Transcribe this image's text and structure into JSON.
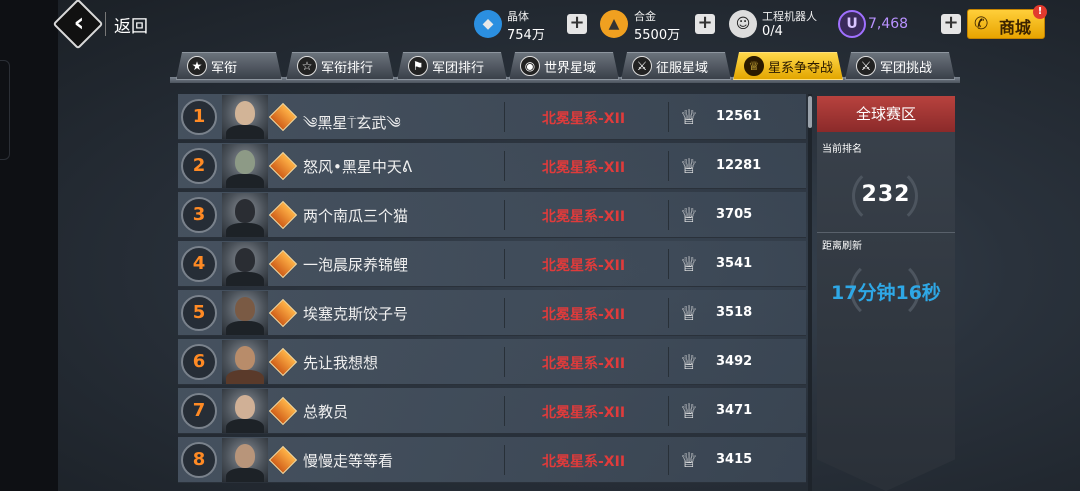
{
  "topbar": {
    "back_label": "返回",
    "resources": [
      {
        "title": "晶体",
        "value": "754万",
        "icon": "crystal-icon",
        "color": "#2b8fe0"
      },
      {
        "title": "合金",
        "value": "5500万",
        "icon": "alloy-icon",
        "color": "#f0a020"
      },
      {
        "title": "工程机器人",
        "value": "0/4",
        "icon": "robot-icon",
        "color": "#dddddd"
      }
    ],
    "currency": {
      "value": "7,468",
      "icon": "u-coin-icon",
      "color": "#a070ff"
    },
    "shop_label": "商城",
    "shop_badge": "!"
  },
  "tabs": [
    {
      "label": "军衔",
      "icon": "rank-icon",
      "active": false
    },
    {
      "label": "军衔排行",
      "icon": "rank-list-icon",
      "active": false
    },
    {
      "label": "军团排行",
      "icon": "legion-rank-icon",
      "active": false
    },
    {
      "label": "世界星域",
      "icon": "world-icon",
      "active": false
    },
    {
      "label": "征服星域",
      "icon": "conquer-icon",
      "active": false
    },
    {
      "label": "星系争夺战",
      "icon": "trophy-icon",
      "active": true
    },
    {
      "label": "军团挑战",
      "icon": "legion-challenge-icon",
      "active": false
    }
  ],
  "rankings": [
    {
      "rank": "1",
      "name": "༄黑星⍑玄武༄",
      "galaxy": "北冕星系-XII",
      "score": "12561"
    },
    {
      "rank": "2",
      "name": "怒风•黑星中天ᕕ",
      "galaxy": "北冕星系-XII",
      "score": "12281"
    },
    {
      "rank": "3",
      "name": "两个南瓜三个猫",
      "galaxy": "北冕星系-XII",
      "score": "3705"
    },
    {
      "rank": "4",
      "name": "一泡晨尿养锦鲤",
      "galaxy": "北冕星系-XII",
      "score": "3541"
    },
    {
      "rank": "5",
      "name": "埃塞克斯饺子号",
      "galaxy": "北冕星系-XII",
      "score": "3518"
    },
    {
      "rank": "6",
      "name": "先让我想想",
      "galaxy": "北冕星系-XII",
      "score": "3492"
    },
    {
      "rank": "7",
      "name": "总教员",
      "galaxy": "北冕星系-XII",
      "score": "3471"
    },
    {
      "rank": "8",
      "name": "慢慢走等等看",
      "galaxy": "北冕星系-XII",
      "score": "3415"
    }
  ],
  "panel": {
    "title": "全球赛区",
    "current_rank_label": "当前排名",
    "current_rank": "232",
    "refresh_label": "距离刷新",
    "refresh_time": "17分钟16秒"
  }
}
